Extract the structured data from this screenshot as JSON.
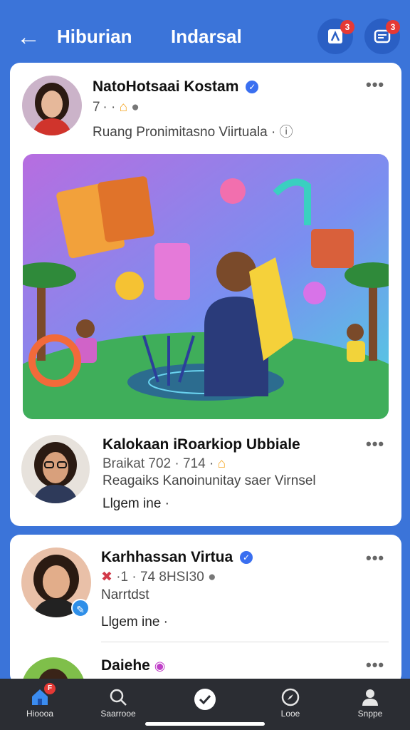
{
  "topbar": {
    "back_icon": "arrow-left-icon",
    "title": "Hiburian",
    "tab": "Indarsal",
    "btn1_badge": "3",
    "btn2_badge": "3"
  },
  "posts": [
    {
      "name": "NatoHotsaai Kostam",
      "meta": "7 · ·",
      "subtitle": "Ruang Pronimitasno Viirtuala ·"
    },
    {
      "name": "Kalokaan iRoarkiop Ubbiale",
      "meta": "Braikat 702 · 714 ·",
      "subtitle": "Reagaiks Kanoinunitay saer Virnsel",
      "line": "Llgem ine ·"
    },
    {
      "name": "Karhhassan Virtua",
      "meta": "·1 · 74 8HSI30",
      "subtitle": "Narrtdst",
      "line": "Llgem ine ·"
    },
    {
      "name": "Daiehe"
    }
  ],
  "nav": [
    {
      "label": "Hioooa",
      "icon": "home-icon",
      "badge": "F"
    },
    {
      "label": "Saarrooe",
      "icon": "search-icon"
    },
    {
      "label": "",
      "icon": "check-icon"
    },
    {
      "label": "Looe",
      "icon": "compass-icon"
    },
    {
      "label": "Snppe",
      "icon": "profile-icon"
    }
  ],
  "colors": {
    "brand_blue": "#3b74d9",
    "nav_dark": "#2b2d33",
    "badge_red": "#e53935",
    "verified": "#3a6ff0"
  }
}
